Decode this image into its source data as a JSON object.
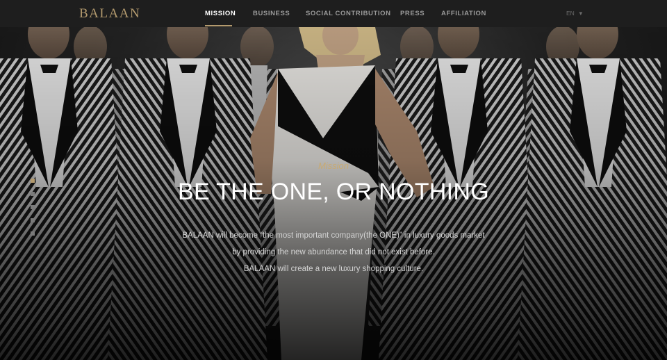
{
  "header": {
    "logo": "BALAAN",
    "nav": [
      {
        "label": "MISSION",
        "active": true
      },
      {
        "label": "BUSINESS",
        "active": false
      },
      {
        "label": "SOCIAL CONTRIBUTION",
        "active": false
      },
      {
        "label": "PRESS",
        "active": false
      },
      {
        "label": "AFFILIATION",
        "active": false
      }
    ],
    "language": "EN",
    "language_icon": "caret-down-icon"
  },
  "hero": {
    "eyebrow": "Mission",
    "headline": "BE THE ONE, OR NOTHING",
    "description": [
      "BALAAN will become “the most important company(the ONE)” in luxury goods market",
      "by providing the new abundance that did not exist before.",
      "BALAAN will create a new luxury shopping culture."
    ],
    "slide_count": 5,
    "active_slide": 1
  },
  "colors": {
    "accent": "#b39a6e",
    "topbar": "#1e1e1e",
    "nav_active": "#ffffff",
    "nav_inactive": "#9a9a9a"
  }
}
